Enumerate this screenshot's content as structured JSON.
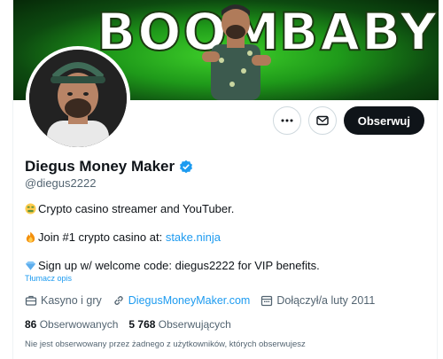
{
  "banner": {
    "text_left": "BOOM",
    "text_right": "BABY!"
  },
  "profile": {
    "name": "Diegus Money Maker",
    "handle": "@diegus2222",
    "bio": {
      "line1_emoji": "money-mouth-face-icon",
      "line1": "Crypto casino streamer and YouTuber.",
      "line2_emoji": "fire-icon",
      "line2_text": "Join #1 crypto casino at: ",
      "line2_link": "stake.ninja",
      "line3_emoji": "gem-icon",
      "line3": "Sign up w/ welcome code: diegus2222 for VIP benefits."
    },
    "translate_label": "Tłumacz opis",
    "meta": {
      "category": "Kasyno i gry",
      "website": "DiegusMoneyMaker.com",
      "joined": "Dołączył/a luty 2011"
    },
    "stats": {
      "following_count": "86",
      "following_label": "Obserwowanych",
      "followers_count": "5 768",
      "followers_label": "Obserwujących"
    },
    "followed_by_note": "Nie jest obserwowany przez żadnego z użytkowników, których obserwujesz"
  },
  "actions": {
    "follow_label": "Obserwuj"
  },
  "colors": {
    "accent": "#1d9bf0",
    "follow_bg": "#0f1419",
    "banner_green": "#2db81f"
  }
}
